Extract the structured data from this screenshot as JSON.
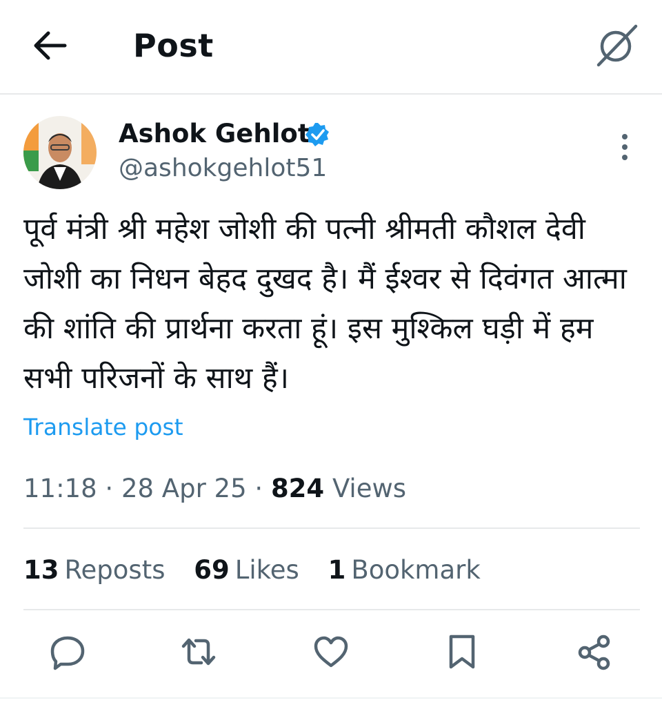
{
  "header": {
    "title": "Post",
    "back_icon": "arrow-left-icon",
    "right_icon": "grok-icon"
  },
  "author": {
    "display_name": "Ashok Gehlot",
    "handle": "@ashokgehlot51",
    "verified": true,
    "verified_color": "#1d9bf0"
  },
  "post": {
    "text": "पूर्व मंत्री श्री महेश जोशी की पत्नी श्रीमती कौशल देवी जोशी का निधन बेहद दुखद है। मैं ईश्वर से दिवंगत आत्मा की शांति की प्रार्थना करता हूं। इस मुश्किल घड़ी में हम सभी परिजनों के साथ हैं।",
    "translate_label": "Translate post",
    "time": "11:18",
    "date": "28 Apr 25",
    "separator": "·",
    "views_count": "824",
    "views_label": "Views"
  },
  "stats": {
    "reposts_count": "13",
    "reposts_label": "Reposts",
    "likes_count": "69",
    "likes_label": "Likes",
    "bookmarks_count": "1",
    "bookmarks_label": "Bookmark"
  },
  "actions": [
    "reply-icon",
    "repost-icon",
    "like-icon",
    "bookmark-icon",
    "share-icon"
  ],
  "colors": {
    "accent": "#1d9bf0",
    "secondary_text": "#536471",
    "primary_text": "#0f1419",
    "divider": "#e7e9ea"
  }
}
